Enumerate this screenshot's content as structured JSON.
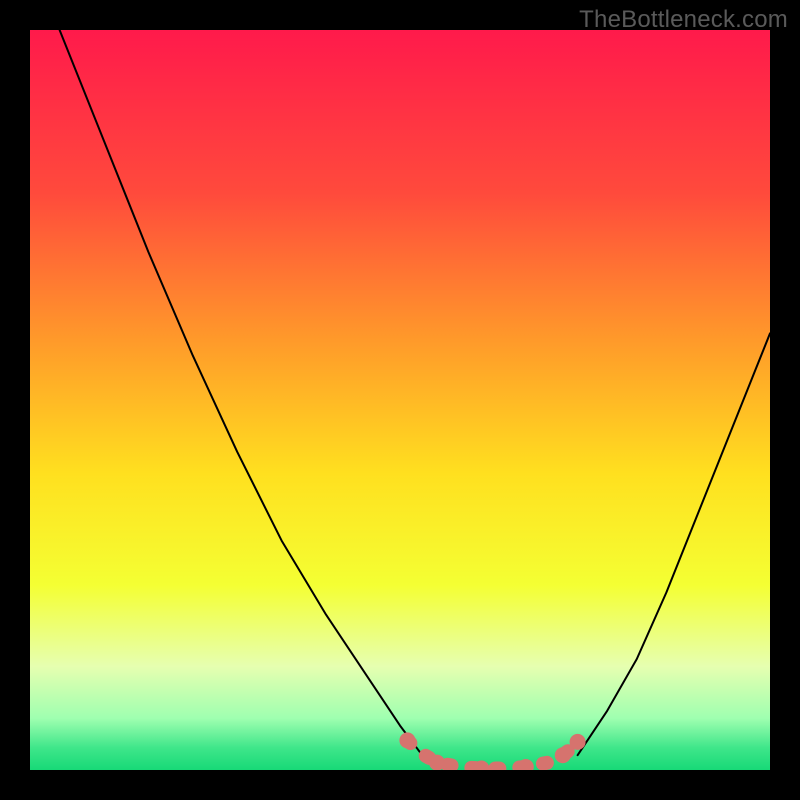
{
  "watermark": "TheBottleneck.com",
  "chart_data": {
    "type": "line",
    "title": "",
    "xlabel": "",
    "ylabel": "",
    "xlim": [
      0,
      100
    ],
    "ylim": [
      0,
      100
    ],
    "grid": false,
    "legend": false,
    "background_gradient": {
      "stops": [
        {
          "pos": 0.0,
          "color": "#ff1a4b"
        },
        {
          "pos": 0.22,
          "color": "#ff4a3c"
        },
        {
          "pos": 0.42,
          "color": "#ff9a2a"
        },
        {
          "pos": 0.6,
          "color": "#ffe01f"
        },
        {
          "pos": 0.75,
          "color": "#f4ff33"
        },
        {
          "pos": 0.86,
          "color": "#e6ffb0"
        },
        {
          "pos": 0.93,
          "color": "#9fffb0"
        },
        {
          "pos": 0.97,
          "color": "#3fe68a"
        },
        {
          "pos": 1.0,
          "color": "#17d977"
        }
      ]
    },
    "series": [
      {
        "name": "left-branch",
        "style": "black-thin",
        "points": [
          {
            "x": 4,
            "y": 100
          },
          {
            "x": 10,
            "y": 85
          },
          {
            "x": 16,
            "y": 70
          },
          {
            "x": 22,
            "y": 56
          },
          {
            "x": 28,
            "y": 43
          },
          {
            "x": 34,
            "y": 31
          },
          {
            "x": 40,
            "y": 21
          },
          {
            "x": 46,
            "y": 12
          },
          {
            "x": 50,
            "y": 6
          },
          {
            "x": 53,
            "y": 2
          }
        ]
      },
      {
        "name": "right-branch",
        "style": "black-thin",
        "points": [
          {
            "x": 74,
            "y": 2
          },
          {
            "x": 78,
            "y": 8
          },
          {
            "x": 82,
            "y": 15
          },
          {
            "x": 86,
            "y": 24
          },
          {
            "x": 90,
            "y": 34
          },
          {
            "x": 94,
            "y": 44
          },
          {
            "x": 98,
            "y": 54
          },
          {
            "x": 100,
            "y": 59
          }
        ]
      },
      {
        "name": "bottom-segment",
        "style": "salmon-thick",
        "points": [
          {
            "x": 51,
            "y": 4.0
          },
          {
            "x": 53,
            "y": 2.2
          },
          {
            "x": 55,
            "y": 1.0
          },
          {
            "x": 58,
            "y": 0.4
          },
          {
            "x": 61,
            "y": 0.2
          },
          {
            "x": 64,
            "y": 0.2
          },
          {
            "x": 67,
            "y": 0.4
          },
          {
            "x": 70,
            "y": 1.0
          },
          {
            "x": 72,
            "y": 2.0
          },
          {
            "x": 73,
            "y": 2.8
          },
          {
            "x": 74,
            "y": 3.8
          }
        ]
      }
    ]
  }
}
